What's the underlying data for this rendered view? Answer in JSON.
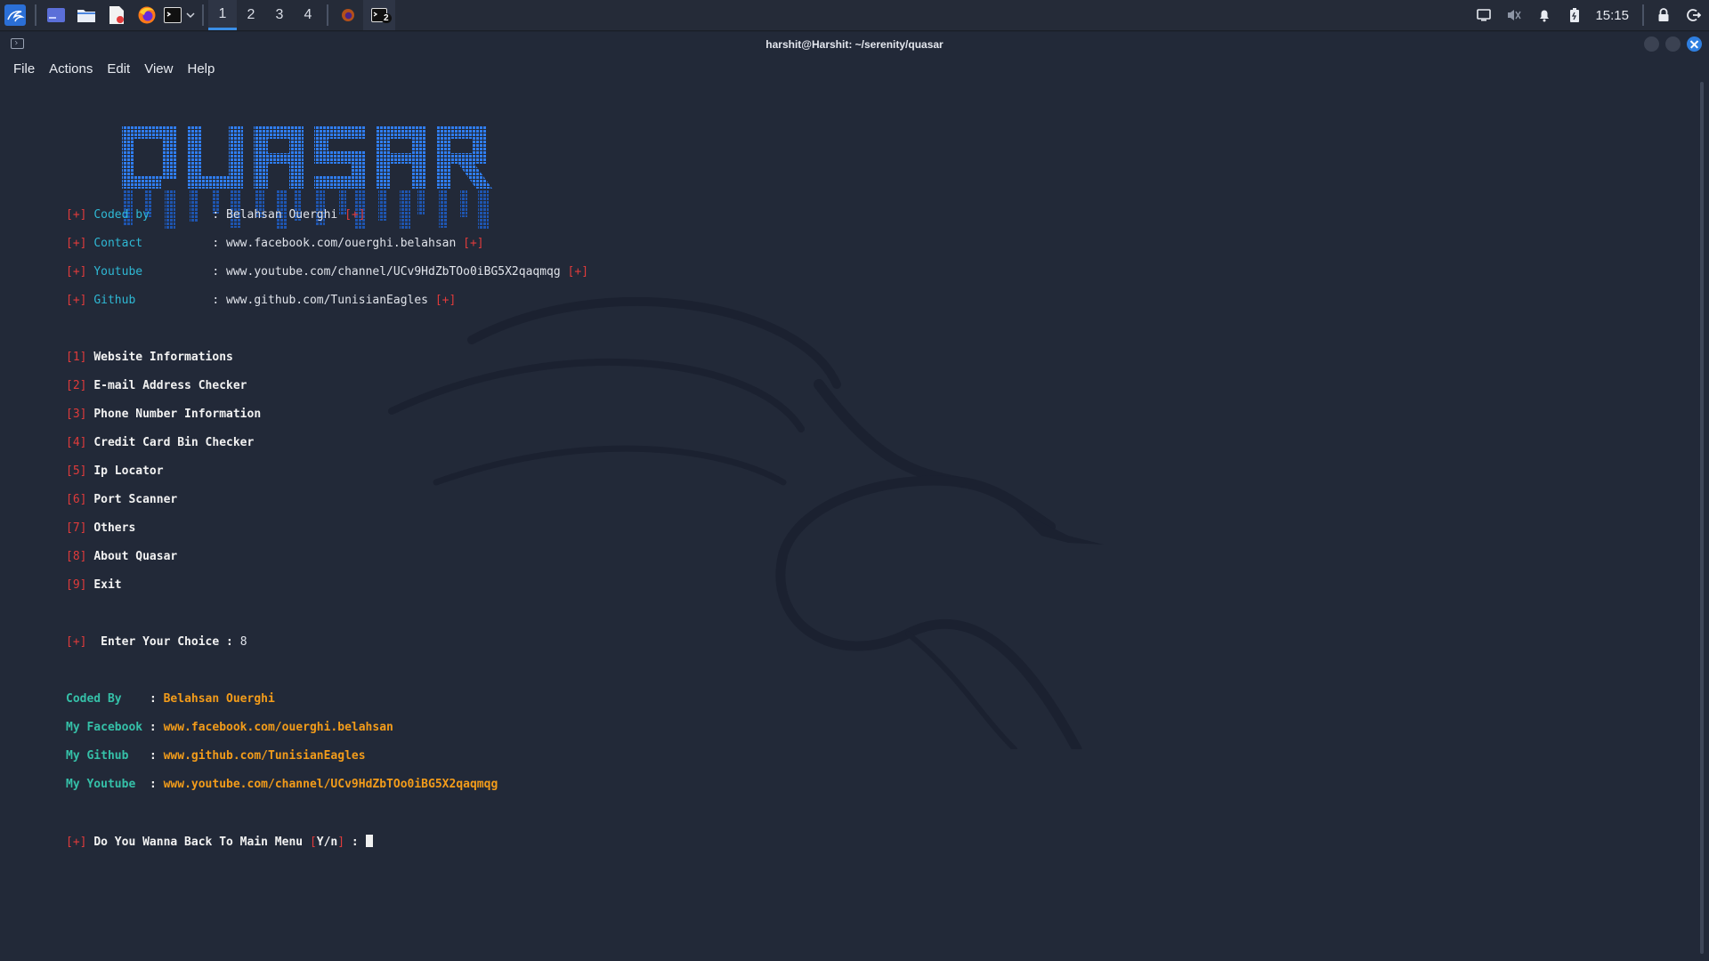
{
  "panel": {
    "workspaces": [
      "1",
      "2",
      "3",
      "4"
    ],
    "active_workspace": "1",
    "clock": "15:15",
    "terminal_badge": "2"
  },
  "window": {
    "title": "harshit@Harshit: ~/serenity/quasar"
  },
  "menubar": [
    "File",
    "Actions",
    "Edit",
    "View",
    "Help"
  ],
  "banner_text": "QUASAR",
  "info": [
    {
      "tag": "[+]",
      "key": "Coded by",
      "value": "Belahsan Ouerghi"
    },
    {
      "tag": "[+]",
      "key": "Contact",
      "value": "www.facebook.com/ouerghi.belahsan"
    },
    {
      "tag": "[+]",
      "key": "Youtube",
      "value": "www.youtube.com/channel/UCv9HdZbTOo0iBG5X2qaqmqg"
    },
    {
      "tag": "[+]",
      "key": "Github",
      "value": "www.github.com/TunisianEagles"
    }
  ],
  "menu_options": [
    {
      "num": "1",
      "label": "Website Informations"
    },
    {
      "num": "2",
      "label": "E-mail Address Checker"
    },
    {
      "num": "3",
      "label": "Phone Number Information"
    },
    {
      "num": "4",
      "label": "Credit Card Bin Checker"
    },
    {
      "num": "5",
      "label": "Ip Locator"
    },
    {
      "num": "6",
      "label": "Port Scanner"
    },
    {
      "num": "7",
      "label": "Others"
    },
    {
      "num": "8",
      "label": "About Quasar"
    },
    {
      "num": "9",
      "label": "Exit"
    }
  ],
  "choice": {
    "tag": "[+]",
    "label": "Enter Your Choice :",
    "value": "8"
  },
  "about": [
    {
      "key": "Coded By",
      "value": "Belahsan Ouerghi"
    },
    {
      "key": "My Facebook",
      "value": "www.facebook.com/ouerghi.belahsan"
    },
    {
      "key": "My Github",
      "value": "www.github.com/TunisianEagles"
    },
    {
      "key": "My Youtube",
      "value": "www.youtube.com/channel/UCv9HdZbTOo0iBG5X2qaqmqg"
    }
  ],
  "prompt": {
    "tag": "[+]",
    "label": "Do You Wanna Back To Main Menu",
    "yn": "Y/n",
    "colon": ":"
  },
  "colors": {
    "accent": "#2f7fe0",
    "red": "#e03b3b",
    "cyan": "#2fb8d4",
    "orange": "#f39c1a",
    "teal": "#35c0a8",
    "banner_blue": "#2f7df0"
  }
}
